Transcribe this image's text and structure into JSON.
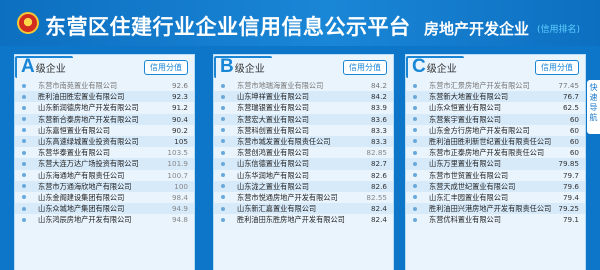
{
  "header": {
    "title": "东营区住建行业企业信用信息公示平台",
    "section": "房地产开发企业",
    "section_sub": "(信用排名)"
  },
  "side_tab": {
    "label": "快速导航"
  },
  "panels": [
    {
      "letter": "A",
      "grade": "级企业",
      "button": "信用分值",
      "rows": [
        {
          "name": "东营市南苑置业有限公司",
          "score": "92.6"
        },
        {
          "name": "胜利油田胜宏置业有限公司",
          "score": "92.3"
        },
        {
          "name": "山东新润德房地产开发有限公司",
          "score": "91.2"
        },
        {
          "name": "东营新合泰房地产开发有限公司",
          "score": "90.4"
        },
        {
          "name": "山东嘉恒置业有限公司",
          "score": "90.2"
        },
        {
          "name": "山东高速绿城置业投资有限公司",
          "score": "105"
        },
        {
          "name": "东营华泰置业有限公司",
          "score": "103.5"
        },
        {
          "name": "东营大连万达广场投资有限公司",
          "score": "101.9"
        },
        {
          "name": "山东海通地产有限责任公司",
          "score": "100.7"
        },
        {
          "name": "东营市万通海欣地产有限公司",
          "score": "100"
        },
        {
          "name": "山东金阁建设集团有限公司",
          "score": "98.4"
        },
        {
          "name": "山东众城地产集团有限公司",
          "score": "94.9"
        },
        {
          "name": "山东鸿辰房地产开发有限公司",
          "score": "94.8"
        }
      ]
    },
    {
      "letter": "B",
      "grade": "级企业",
      "button": "信用分值",
      "rows": [
        {
          "name": "东营市地瑞海置业有限公司",
          "score": "84.2"
        },
        {
          "name": "山东坤祥置业有限公司",
          "score": "84.2"
        },
        {
          "name": "东营瑞银置业有限公司",
          "score": "83.9"
        },
        {
          "name": "东营宏大置业有限公司",
          "score": "83.6"
        },
        {
          "name": "东营科创置业有限公司",
          "score": "83.3"
        },
        {
          "name": "东营市城发置业有限责任公司",
          "score": "83.3"
        },
        {
          "name": "东营创鸿置业有限公司",
          "score": "82.85"
        },
        {
          "name": "山东信德置业有限公司",
          "score": "82.7"
        },
        {
          "name": "山东华润地产有限公司",
          "score": "82.6"
        },
        {
          "name": "山东泷之置业有限公司",
          "score": "82.6"
        },
        {
          "name": "东营市悦通房地产开发有限公司",
          "score": "82.55"
        },
        {
          "name": "山东新汇嘉置业有限公司",
          "score": "82.4"
        },
        {
          "name": "胜利油田东胜房地产开发有限公司",
          "score": "82.4"
        }
      ]
    },
    {
      "letter": "C",
      "grade": "级企业",
      "button": "信用分值",
      "rows": [
        {
          "name": "东营市汇景房地产开发有限公司",
          "score": "77.45"
        },
        {
          "name": "东营新大地置业有限公司",
          "score": "76.7"
        },
        {
          "name": "山东众恒置业有限公司",
          "score": "62.5"
        },
        {
          "name": "东营紫宇置业有限公司",
          "score": "60"
        },
        {
          "name": "山东金方行房地产开发有限公司",
          "score": "60"
        },
        {
          "name": "胜利油田胜利新世纪置业有限责任公司",
          "score": "60"
        },
        {
          "name": "东营市正泰房地产开发有限责任公司",
          "score": "60"
        },
        {
          "name": "山东万里置业有限公司",
          "score": "79.85"
        },
        {
          "name": "东营市世贸置业有限公司",
          "score": "79.7"
        },
        {
          "name": "东营天成世纪置业有限公司",
          "score": "79.6"
        },
        {
          "name": "山东汇丰园置业有限公司",
          "score": "79.4"
        },
        {
          "name": "胜利油田兴港房地产开发有限责任公司",
          "score": "79.25"
        },
        {
          "name": "东营优科置业有限公司",
          "score": "79.1"
        }
      ]
    }
  ]
}
